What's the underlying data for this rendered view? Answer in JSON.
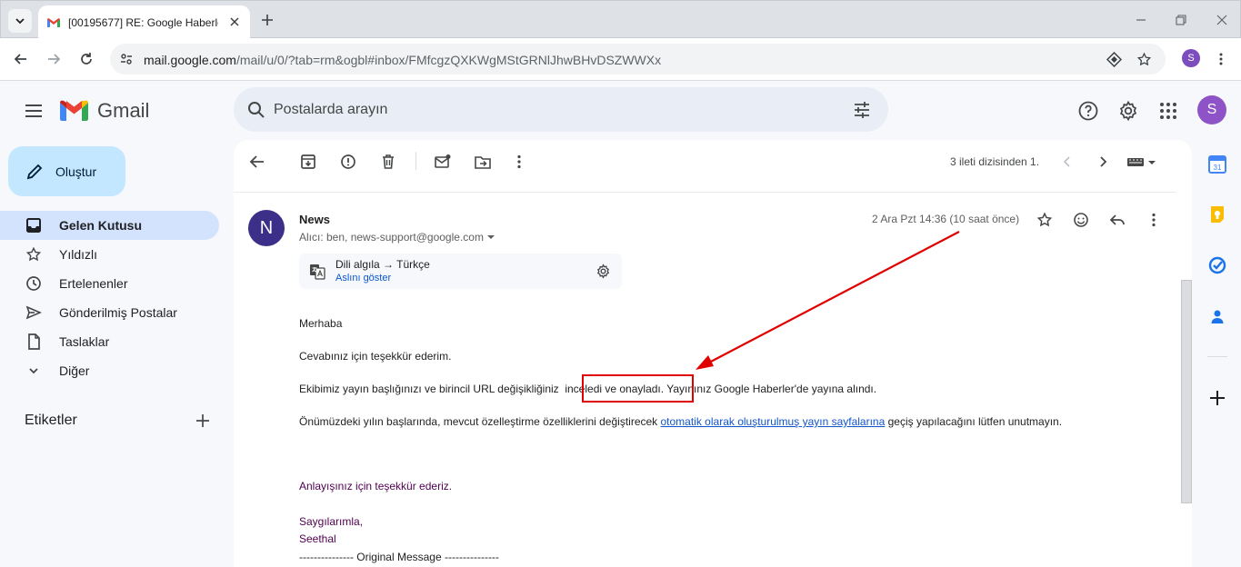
{
  "browser": {
    "tab_title": "[00195677] RE: Google Haberler",
    "url_host": "mail.google.com",
    "url_path": "/mail/u/0/?tab=rm&ogbl#inbox/FMfcgzQXKWgMStGRNlJhwBHvDSZWWXx",
    "profile_initial": "S"
  },
  "app": {
    "name": "Gmail",
    "search_placeholder": "Postalarda arayın",
    "avatar_initial": "S"
  },
  "sidebar": {
    "compose_label": "Oluştur",
    "items": [
      {
        "label": "Gelen Kutusu",
        "icon": "inbox-icon",
        "active": true
      },
      {
        "label": "Yıldızlı",
        "icon": "star-icon"
      },
      {
        "label": "Ertelenenler",
        "icon": "clock-icon"
      },
      {
        "label": "Gönderilmiş Postalar",
        "icon": "send-icon"
      },
      {
        "label": "Taslaklar",
        "icon": "draft-icon"
      },
      {
        "label": "Diğer",
        "icon": "chevron-down-icon"
      }
    ],
    "labels_header": "Etiketler"
  },
  "toolbar": {
    "pager_text": "3 ileti dizisinden 1."
  },
  "message": {
    "sender_initial": "N",
    "sender": "News",
    "to_line": "Alıcı: ben, news-support@google.com",
    "date": "2 Ara Pzt 14:36 (10 saat önce)",
    "translate_lang": "Dili algıla → Türkçe",
    "translate_show_original": "Aslını göster",
    "greeting": "Merhaba",
    "line_thanks": "Cevabınız için teşekkür ederim.",
    "line_review_before": "Ekibimiz yayın başlığınızı ve birincil URL değişikliğiniz",
    "line_review_highlight": "inceledi ve onayladı.",
    "line_review_after": " Yayınınız Google Haberler'de yayına alındı.",
    "line_future_before": "Önümüzdeki yılın başlarında, mevcut özelleştirme özelliklerini değiştirecek ",
    "line_future_link": "otomatik olarak oluşturulmuş yayın sayfalarına",
    "line_future_after": " geçiş yapılacağını lütfen unutmayın.",
    "line_understanding": "Anlayışınız için teşekkür ederiz.",
    "signoff": "Saygılarımla,",
    "signature": "Seethal",
    "original_marker": "--------------- Original Message ---------------"
  },
  "colors": {
    "active_nav": "#d3e3fd",
    "compose": "#c2e7ff",
    "annotation_red": "#e00000",
    "link": "#1155cc"
  }
}
